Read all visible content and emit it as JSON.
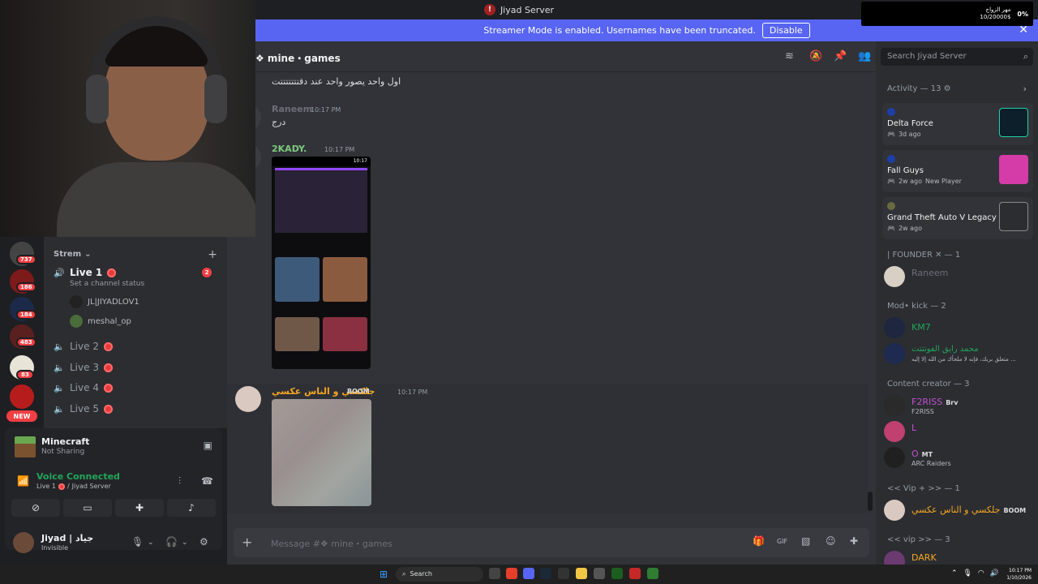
{
  "window": {
    "title": "Jiyad Server"
  },
  "widget": {
    "line1": "مهر الزواج",
    "line2": "10/20000$",
    "pct": "0%"
  },
  "banner": {
    "text": "Streamer Mode is enabled. Usernames have been truncated.",
    "disable": "Disable",
    "close": "✕"
  },
  "rail": {
    "badges": [
      "737",
      "186",
      "184",
      "483",
      "83"
    ],
    "new": "NEW"
  },
  "channels": {
    "category": "Strem",
    "category_chevron": "⌄",
    "add": "+",
    "live1": {
      "name": "Live 1",
      "status": "Set a channel status",
      "count": "2"
    },
    "users": [
      "JL|JIYADLOV1",
      "meshal_op"
    ],
    "others": [
      "Live 2",
      "Live 3",
      "Live 4",
      "Live 5"
    ]
  },
  "activity": {
    "game": "Minecraft",
    "sub": "Not Sharing"
  },
  "voice": {
    "status": "Voice Connected",
    "channel": "Live 1",
    "sep": "/",
    "server": "Jiyad Server"
  },
  "me": {
    "name": "Jiyad | جياد",
    "status": "Invisible"
  },
  "chat": {
    "channel": "❖ mine・games",
    "messages": [
      {
        "author": "",
        "time": "",
        "text": "اول واحد يصور واحد عند دقتتتتتتتت"
      },
      {
        "author": "Raneem",
        "time": "10:17 PM",
        "text": "درج"
      },
      {
        "author": "2KADY.",
        "time": "10:17 PM",
        "text": ""
      },
      {
        "author": "جلكسي و الناس عكسي",
        "tag": "BOOM",
        "time": "10:17 PM",
        "text": ""
      }
    ],
    "phone_time": "10:17",
    "placeholder": "Message #❖ mine・games"
  },
  "members": {
    "search": "Search Jiyad Server",
    "activity_title": "Activity — 13",
    "activities": [
      {
        "game": "Delta Force",
        "meta": "3d ago",
        "extra": ""
      },
      {
        "game": "Fall Guys",
        "meta": "2w ago",
        "extra": "New Player"
      },
      {
        "game": "Grand Theft Auto V Legacy",
        "meta": "2w ago",
        "extra": ""
      }
    ],
    "sections": [
      {
        "title": "| FOUNDER ✕ — 1",
        "members": [
          {
            "name": "Raneem",
            "sub": ""
          }
        ]
      },
      {
        "title": "Mod• kick — 2",
        "members": [
          {
            "name": "KM7",
            "sub": ""
          },
          {
            "name": "محمد رايق الفوتتتت",
            "sub": "متعلق بربك، فإنه لا ملجأك من الله إلا إليه ..."
          }
        ]
      },
      {
        "title": "Content creator — 3",
        "members": [
          {
            "name": "F2RISS",
            "tag": "Brv",
            "sub": "F2RISS"
          },
          {
            "name": "L",
            "sub": ""
          },
          {
            "name": "O",
            "tag": "MT",
            "sub": "ARC Raiders"
          }
        ]
      },
      {
        "title": "<< Vip + >> — 1",
        "members": [
          {
            "name": "جلكسي و الناس عكسي",
            "tag": "BOOM",
            "sub": ""
          }
        ]
      },
      {
        "title": "<< vip >> — 3",
        "members": [
          {
            "name": "DARK",
            "sub": ""
          }
        ]
      }
    ]
  },
  "taskbar": {
    "search": "Search",
    "time": "10:17 PM",
    "date": "1/10/2026"
  },
  "colors": {
    "accent": "#5865f2",
    "online": "#23a55a",
    "danger": "#f23f43"
  }
}
